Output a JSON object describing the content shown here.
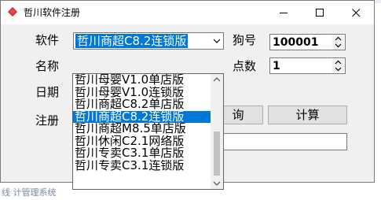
{
  "background": {
    "bottom_text": "线 计管理系统"
  },
  "window": {
    "title": "哲川软件注册",
    "icon": "red-diamond-icon",
    "accent_color": "#0078d7"
  },
  "labels": {
    "software": "软件",
    "name": "名称",
    "date": "日期",
    "register": "注册",
    "dongle": "狗号",
    "points": "点数"
  },
  "software_combo": {
    "selected": "哲川商超C8.2连锁版",
    "options": [
      "哲川母婴V1.0单店版",
      "哲川母婴V1.0连锁版",
      "哲川商超C8.2单店版",
      "哲川商超C8.2连锁版",
      "哲川商超M8.5单店版",
      "哲川休闲C2.1网络版",
      "哲川专卖C3.1单店版",
      "哲川专卖C3.1连锁版"
    ],
    "highlighted_index": 3
  },
  "dongle_input": {
    "value": "100001"
  },
  "points_input": {
    "value": "1"
  },
  "buttons": {
    "query_partial": "询",
    "calculate": "计算"
  },
  "register_field": {
    "value": ""
  }
}
